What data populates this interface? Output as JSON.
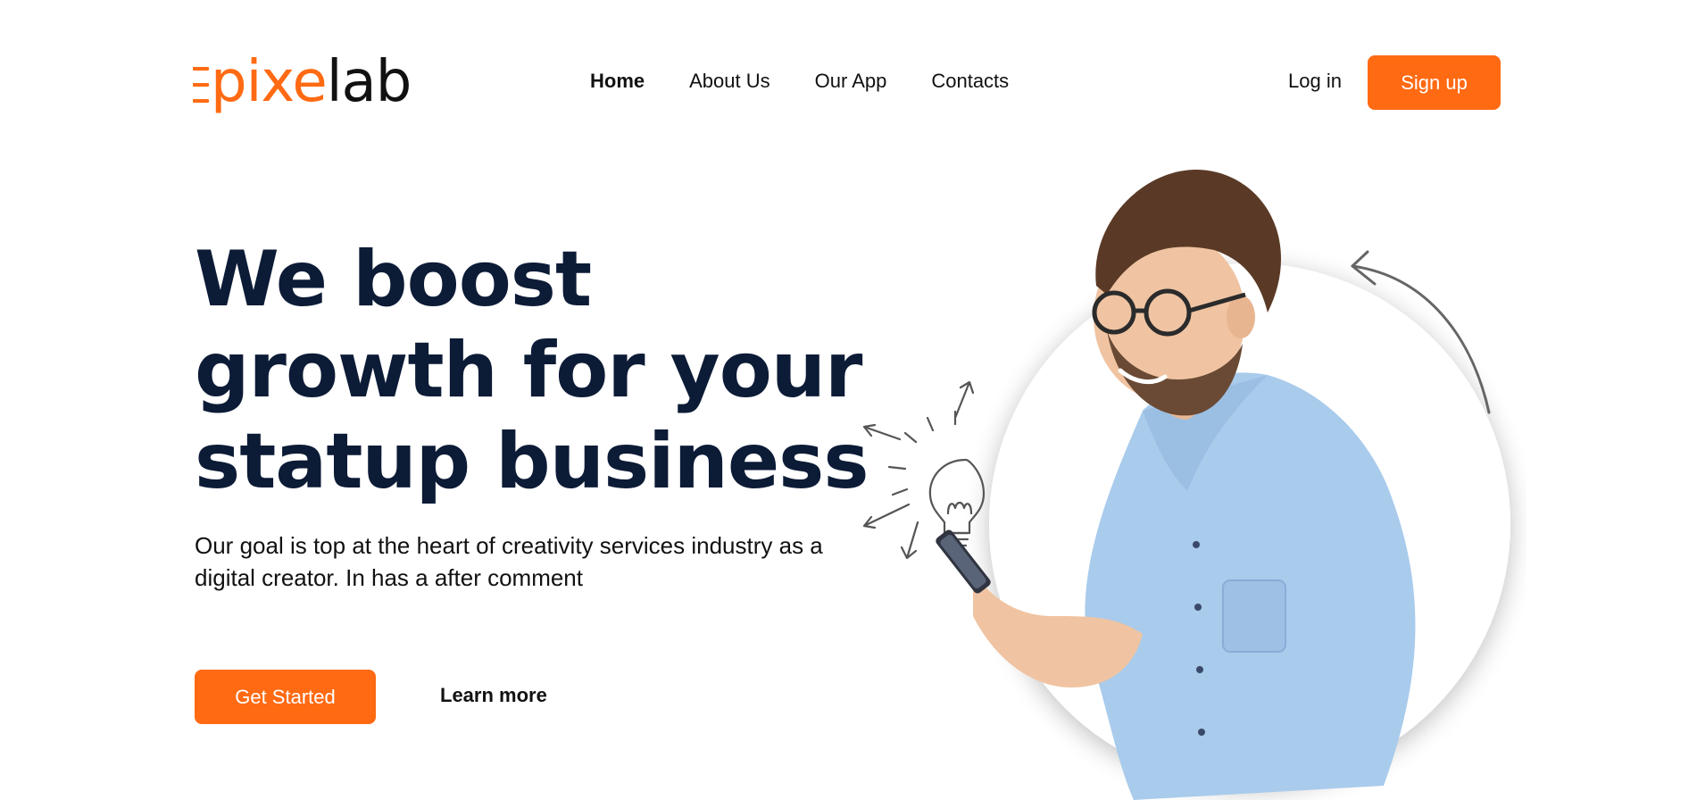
{
  "brand": {
    "logo_prefix": "pixe",
    "logo_suffix": "lab"
  },
  "nav": {
    "items": [
      {
        "label": "Home",
        "active": true
      },
      {
        "label": "About Us",
        "active": false
      },
      {
        "label": "Our App",
        "active": false
      },
      {
        "label": "Contacts",
        "active": false
      }
    ]
  },
  "auth": {
    "login_label": "Log in",
    "signup_label": "Sign up"
  },
  "hero": {
    "headline_lines": [
      "We boost",
      "growth for your",
      "statup business"
    ],
    "subtext": "Our goal is top at the heart of creativity services industry as a digital creator. In has a after comment",
    "primary_cta": "Get Started",
    "secondary_cta": "Learn more"
  },
  "colors": {
    "accent": "#ff6a13",
    "heading": "#0c1b36",
    "shirt": "#a9cbec"
  },
  "icons": [
    "lightbulb-icon",
    "curved-arrow-icon"
  ]
}
